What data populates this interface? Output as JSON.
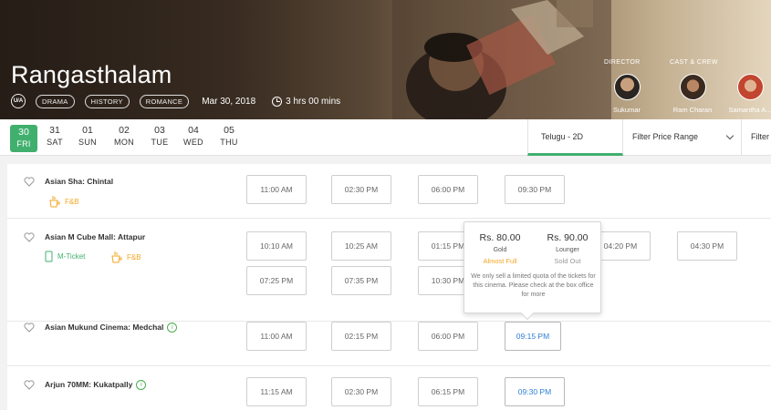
{
  "movie": {
    "title": "Rangasthalam",
    "certificate": "U/A",
    "genres": [
      "DRAMA",
      "HISTORY",
      "ROMANCE"
    ],
    "release_date": "Mar 30, 2018",
    "duration": "3 hrs 00 mins"
  },
  "crew": {
    "director_heading": "DIRECTOR",
    "cast_heading": "CAST & CREW",
    "people": [
      "Sukumar",
      "Ram Charan",
      "Samantha A..."
    ]
  },
  "dates": [
    {
      "day": "30",
      "weekday": "FRI",
      "active": true
    },
    {
      "day": "31",
      "weekday": "SAT"
    },
    {
      "day": "01",
      "weekday": "SUN"
    },
    {
      "day": "02",
      "weekday": "MON"
    },
    {
      "day": "03",
      "weekday": "TUE"
    },
    {
      "day": "04",
      "weekday": "WED"
    },
    {
      "day": "05",
      "weekday": "THU"
    }
  ],
  "filters": {
    "language": "Telugu - 2D",
    "price": "Filter Price Range",
    "other": "Filter"
  },
  "venues": [
    {
      "name": "Asian Sha: Chintal",
      "tags": [
        "F&B"
      ],
      "showtimes": [
        "11:00 AM",
        "02:30 PM",
        "06:00 PM",
        "09:30 PM"
      ]
    },
    {
      "name": "Asian M Cube Mall: Attapur",
      "tags": [
        "M-Ticket",
        "F&B"
      ],
      "showtimes": [
        "10:10 AM",
        "10:25 AM",
        "01:15 PM",
        "04:20 PM",
        "04:30 PM",
        "07:25 PM",
        "07:35 PM",
        "10:30 PM"
      ]
    },
    {
      "name": "Asian Mukund Cinema: Medchal",
      "info_icon": "i",
      "showtimes": [
        "11:00 AM",
        "02:15 PM",
        "06:00 PM",
        "09:15 PM"
      ]
    },
    {
      "name": "Arjun 70MM: Kukatpally",
      "info_icon": "i",
      "showtimes": [
        "11:15 AM",
        "02:30 PM",
        "06:15 PM",
        "09:30 PM"
      ]
    }
  ],
  "tooltip": {
    "classes": [
      {
        "price": "Rs. 80.00",
        "name": "Gold",
        "availability": "Almost Full",
        "color": "#f5a623"
      },
      {
        "price": "Rs. 90.00",
        "name": "Lounger",
        "availability": "Sold Out",
        "color": "#999999"
      }
    ],
    "note": "We only sell a limited quota of the tickets for this cinema. Please check at the box office for more"
  },
  "colors": {
    "accent": "#41b06e",
    "fb": "#f5a623",
    "link": "#2f7fd4"
  }
}
